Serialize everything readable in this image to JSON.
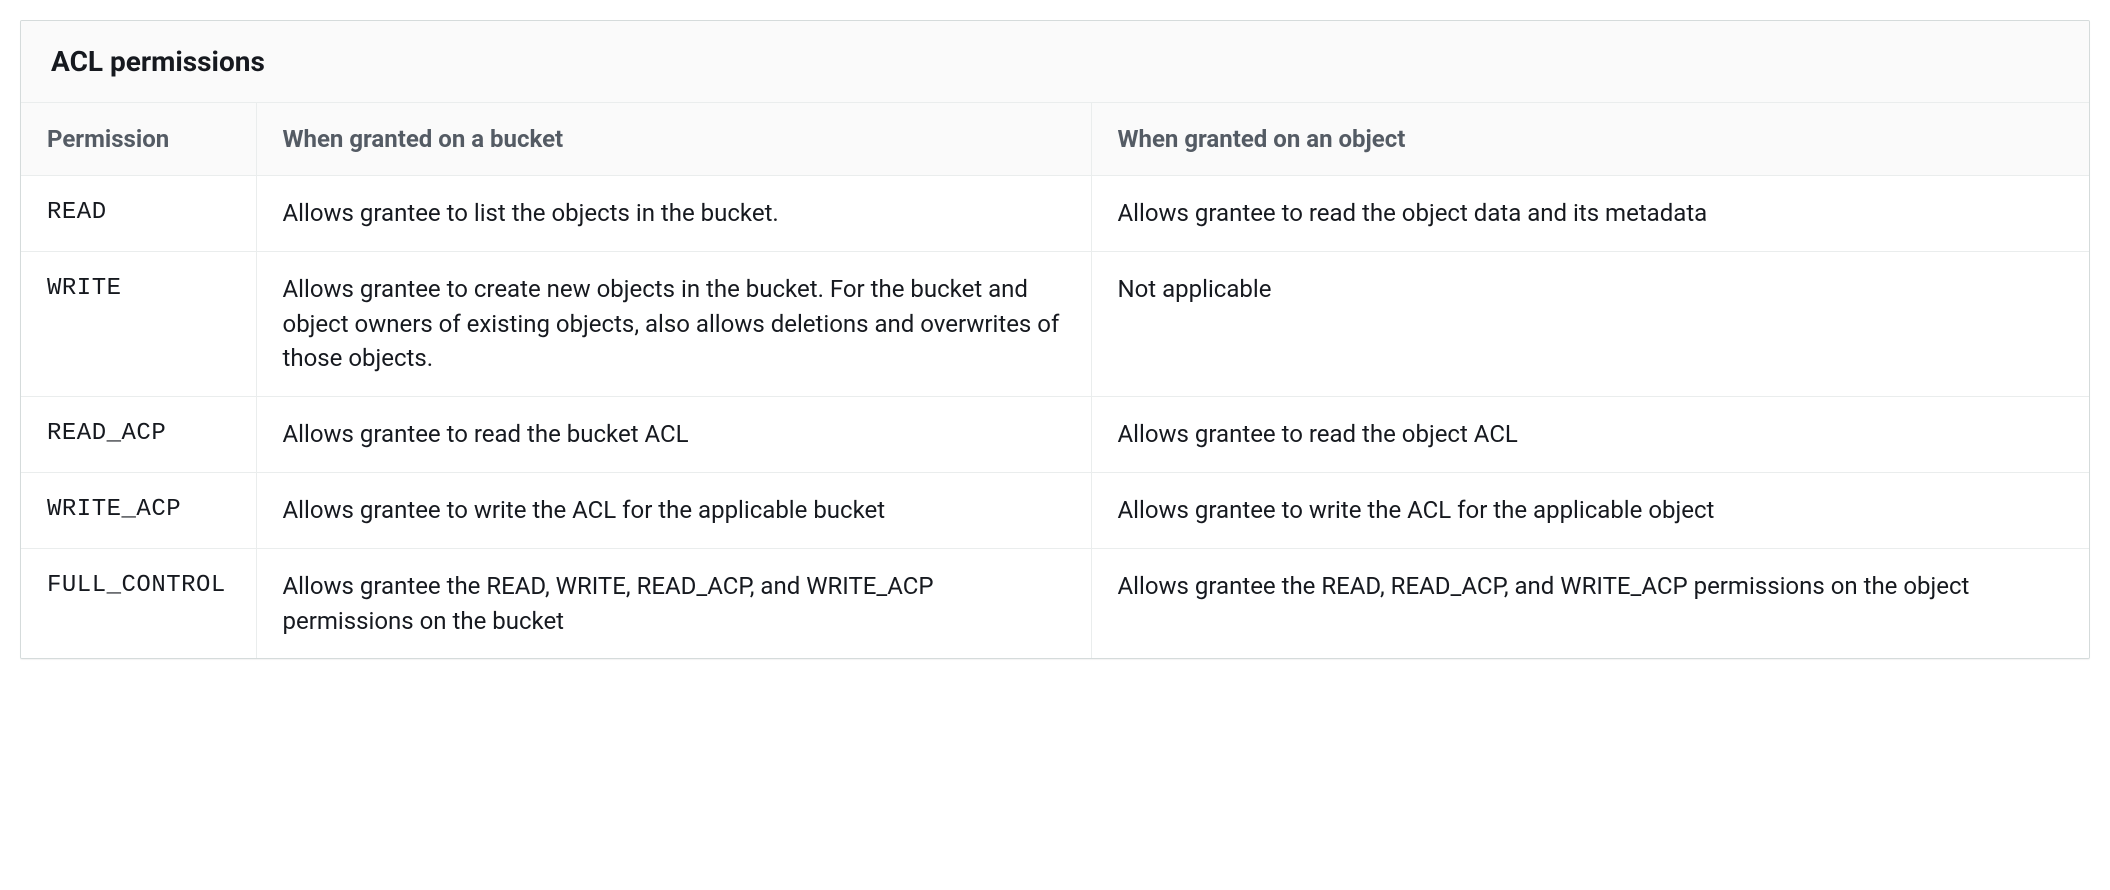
{
  "table": {
    "title": "ACL permissions",
    "headers": {
      "permission": "Permission",
      "bucket": "When granted on a bucket",
      "object": "When granted on an object"
    },
    "rows": [
      {
        "permission": "READ",
        "bucket": "Allows grantee to list the objects in the bucket.",
        "object": "Allows grantee to read the object data and its metadata"
      },
      {
        "permission": "WRITE",
        "bucket": "Allows grantee to create new objects in the bucket. For the bucket and object owners of existing objects, also allows deletions and overwrites of those objects.",
        "object": "Not applicable"
      },
      {
        "permission": "READ_ACP",
        "bucket": "Allows grantee to read the bucket ACL",
        "object": "Allows grantee to read the object ACL"
      },
      {
        "permission": "WRITE_ACP",
        "bucket": "Allows grantee to write the ACL for the applicable bucket",
        "object": "Allows grantee to write the ACL for the applicable object"
      },
      {
        "permission": "FULL_CONTROL",
        "bucket": "Allows grantee the READ, WRITE, READ_ACP, and WRITE_ACP permissions on the bucket",
        "object": "Allows grantee the READ, READ_ACP, and WRITE_ACP permissions on the object"
      }
    ]
  }
}
